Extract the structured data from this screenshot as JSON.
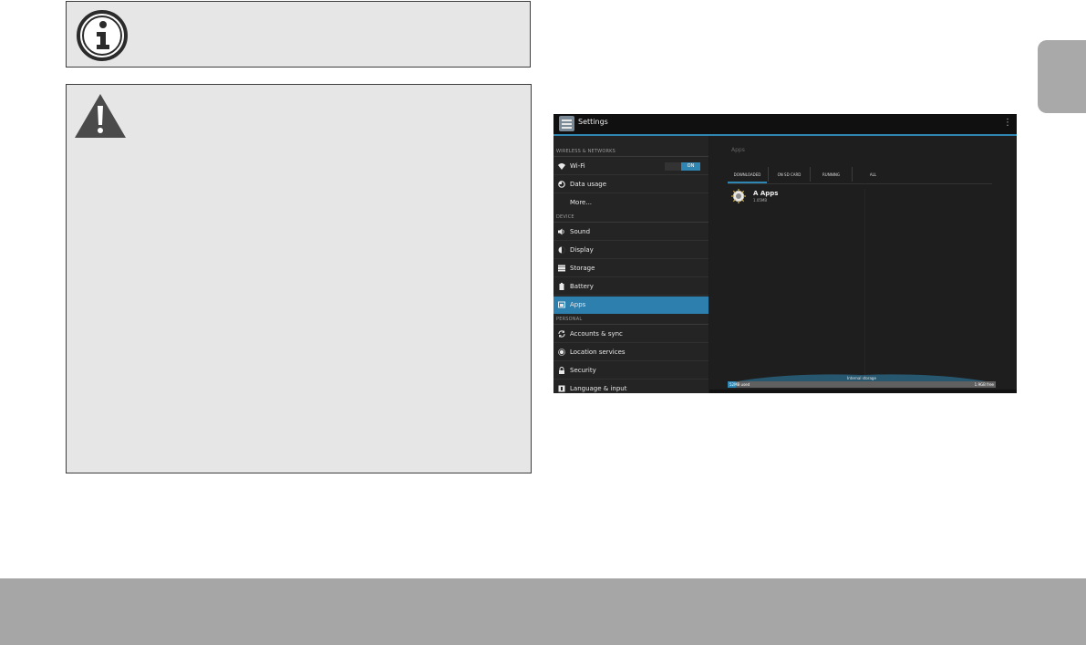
{
  "colors": {
    "accent": "#2f86b3",
    "callout_bg": "#e6e6e6",
    "tab_gray": "#a9a9a9",
    "footer_gray": "#a6a6a6"
  },
  "callouts": {
    "info_icon": "info-icon",
    "warning_icon": "warning-icon"
  },
  "screenshot": {
    "action_bar": {
      "title": "Settings",
      "overflow_icon": "⋮"
    },
    "sidebar": {
      "sections": [
        {
          "header": "WIRELESS & NETWORKS",
          "items": [
            {
              "label": "Wi-Fi",
              "icon": "wifi-icon",
              "toggle": "ON"
            },
            {
              "label": "Data usage",
              "icon": "data-usage-icon"
            },
            {
              "label": "More...",
              "icon": ""
            }
          ]
        },
        {
          "header": "DEVICE",
          "items": [
            {
              "label": "Sound",
              "icon": "speaker-icon"
            },
            {
              "label": "Display",
              "icon": "display-icon"
            },
            {
              "label": "Storage",
              "icon": "storage-icon"
            },
            {
              "label": "Battery",
              "icon": "battery-icon"
            },
            {
              "label": "Apps",
              "icon": "apps-icon",
              "selected": true
            }
          ]
        },
        {
          "header": "PERSONAL",
          "items": [
            {
              "label": "Accounts & sync",
              "icon": "sync-icon"
            },
            {
              "label": "Location services",
              "icon": "location-icon"
            },
            {
              "label": "Security",
              "icon": "lock-icon"
            },
            {
              "label": "Language & input",
              "icon": "language-icon"
            }
          ]
        }
      ]
    },
    "apps_page": {
      "title": "Apps",
      "tabs": [
        "DOWNLOADED",
        "ON SD CARD",
        "RUNNING",
        "ALL"
      ],
      "active_tab": "DOWNLOADED",
      "apps": [
        {
          "name": "A Apps",
          "size": "1.05MB",
          "icon": "app-icon"
        }
      ],
      "storage": {
        "label": "Internal storage",
        "used": "52MB used",
        "free": "1.9GB free",
        "used_fraction": 0.03
      }
    }
  }
}
